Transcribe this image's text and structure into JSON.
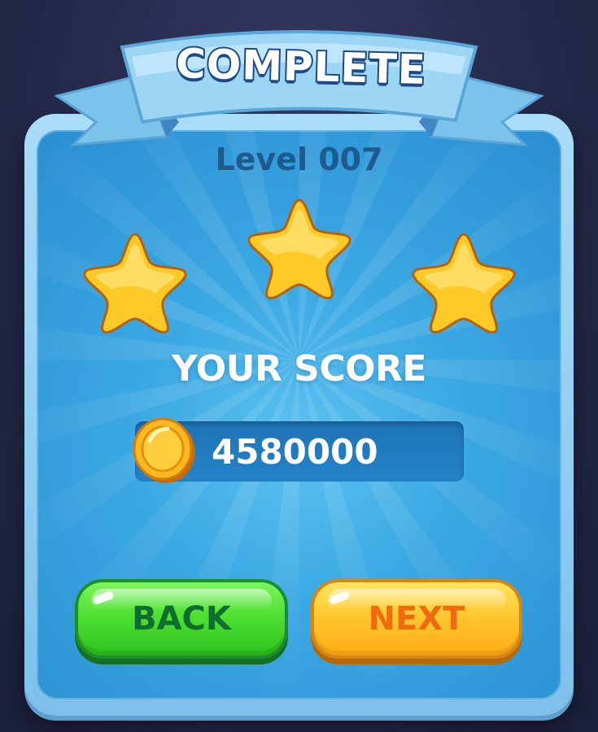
{
  "dialog": {
    "title": "COMPLETE",
    "level": "Level 007",
    "stars": {
      "earned": 3,
      "total": 3
    },
    "score_label": "YOUR SCORE",
    "score_value": "4580000"
  },
  "buttons": {
    "back_label": "BACK",
    "next_label": "NEXT"
  },
  "icons": {
    "star": "star-icon",
    "coin": "coin-icon"
  },
  "colors": {
    "background": "#262a4c",
    "panel": "#3ba8e3",
    "ribbon": "#8fd0f3",
    "star": "#ffc928",
    "back_button": "#4fe033",
    "next_button": "#ffc52c",
    "next_text": "#f06a0f",
    "back_text": "#0f6e2f"
  }
}
